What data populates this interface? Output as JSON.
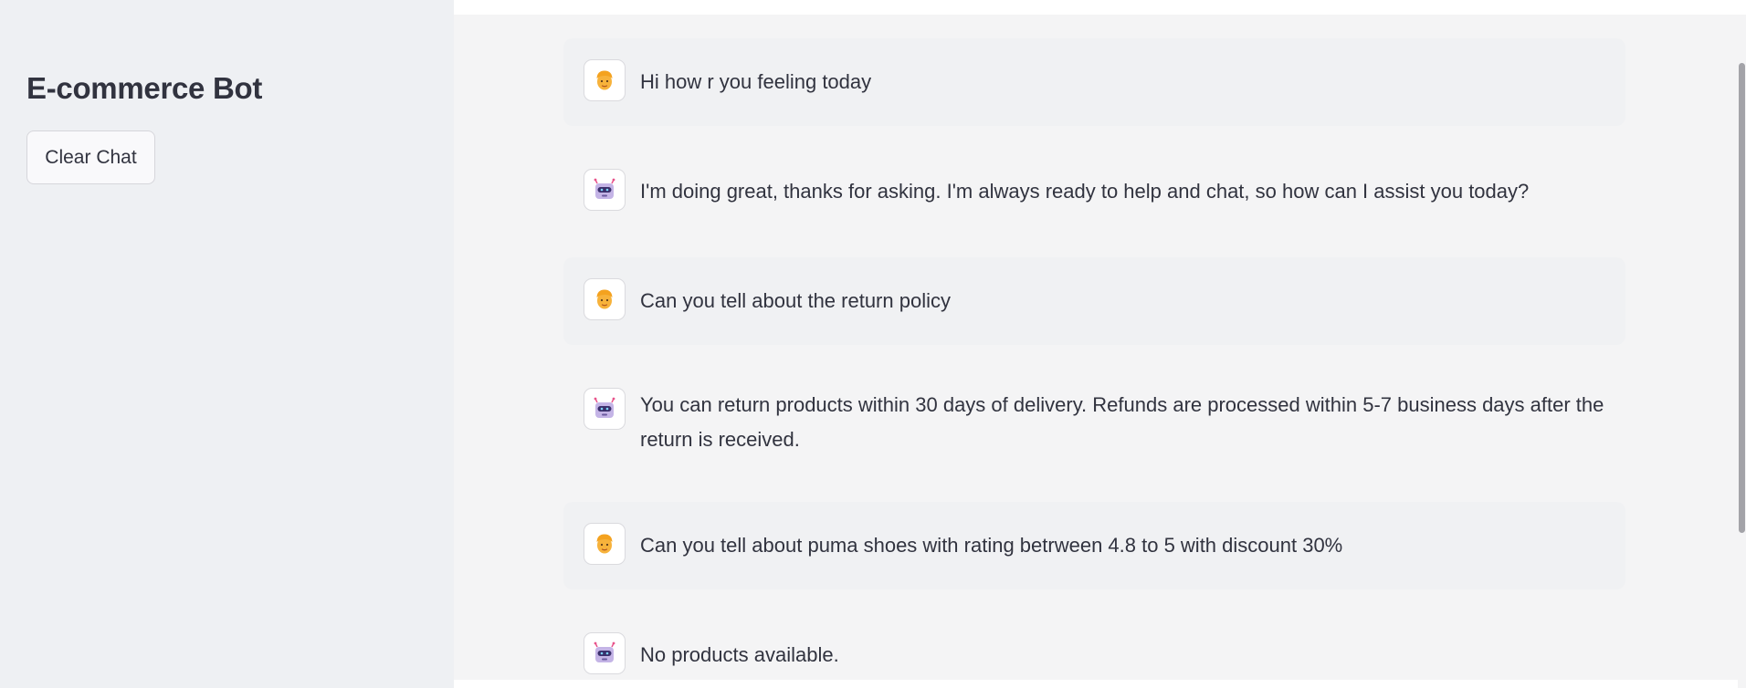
{
  "sidebar": {
    "title": "E-commerce Bot",
    "clear_button_label": "Clear Chat"
  },
  "messages": [
    {
      "role": "user",
      "avatar_icon": "person-face-icon",
      "text": "Hi how r you feeling today"
    },
    {
      "role": "assistant",
      "avatar_icon": "robot-face-icon",
      "text": "I'm doing great, thanks for asking. I'm always ready to help and chat, so how can I assist you today?"
    },
    {
      "role": "user",
      "avatar_icon": "person-face-icon",
      "text": "Can you tell about the return policy"
    },
    {
      "role": "assistant",
      "avatar_icon": "robot-face-icon",
      "text": "You can return products within 30 days of delivery. Refunds are processed within 5-7 business days after the return is received."
    },
    {
      "role": "user",
      "avatar_icon": "person-face-icon",
      "text": "Can you tell about puma shoes with rating betrween 4.8 to 5 with discount 30%"
    },
    {
      "role": "assistant",
      "avatar_icon": "robot-face-icon",
      "text": "No products available."
    }
  ],
  "colors": {
    "sidebar_bg": "#eef0f3",
    "main_bg": "#f4f4f5",
    "user_bubble_bg": "#f0f1f3",
    "text": "#31333f"
  }
}
